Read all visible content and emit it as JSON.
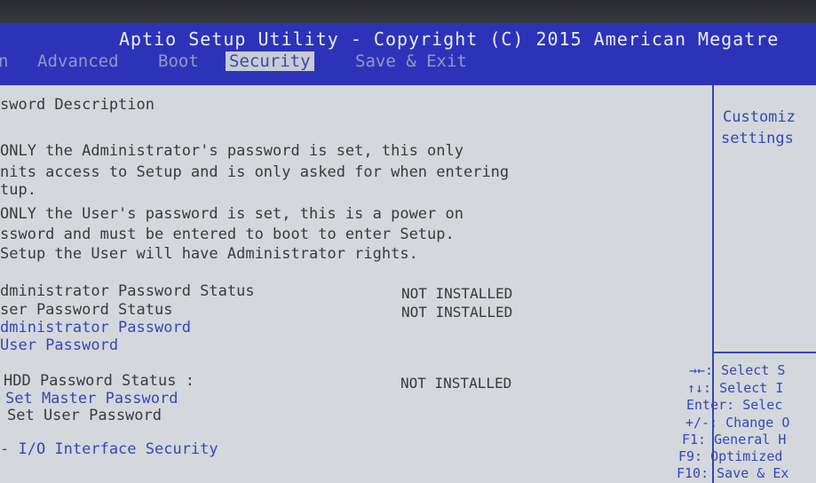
{
  "title": "Aptio Setup Utility - Copyright (C) 2015 American Megatre",
  "tabs": [
    "n",
    "Advanced",
    "Boot",
    "Security",
    "Save & Exit"
  ],
  "active_tab": "Security",
  "description": {
    "heading": "sword Description",
    "lines": [
      "ONLY the Administrator's password is set, this only",
      "nits access to Setup and is only asked for when entering",
      "tup.",
      " ONLY the User's password is set, this is a power on",
      "ssword and must be entered to boot to enter Setup.",
      " Setup the User will have Administrator rights."
    ]
  },
  "status": {
    "admin_label": "dministrator Password Status",
    "admin_value": "NOT INSTALLED",
    "user_label": "ser Password Status",
    "user_value": "NOT INSTALLED"
  },
  "links": {
    "admin_password": "dministrator Password",
    "user_password": "User Password"
  },
  "hdd": {
    "label": "HDD Password Status  :",
    "value": "NOT INSTALLED",
    "master": "Set Master Password",
    "user": "Set User Password"
  },
  "io_security": "- I/O Interface Security",
  "help_panel": {
    "line1": "Customiz",
    "line2": "settings"
  },
  "keys": [
    "→←: Select S",
    "↑↓: Select I",
    "Enter: Selec",
    "+/-: Change O",
    "F1: General H",
    "F9: Optimized",
    "F10: Save & Ex"
  ],
  "colors": {
    "title_bar": "#2d33b8",
    "screen_bg": "#d4d8dc",
    "accent_text": "#3846b4"
  }
}
